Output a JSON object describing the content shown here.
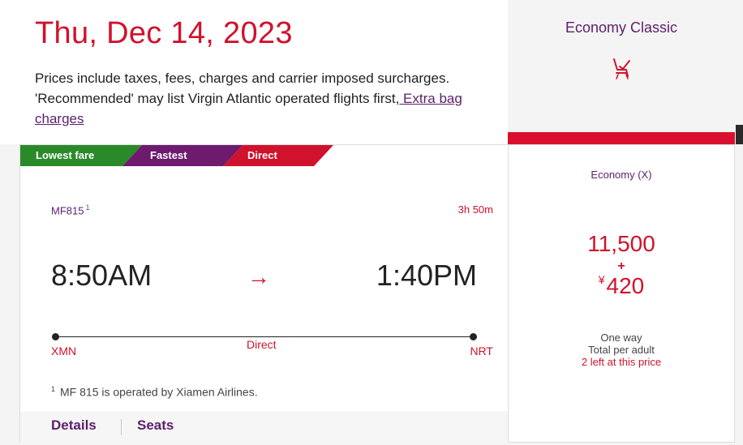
{
  "header": {
    "date": "Thu, Dec 14, 2023",
    "note_text": "Prices include taxes, fees, charges and carrier imposed surcharges. 'Recommended' may list Virgin Atlantic operated flights first,",
    "bag_link": " Extra bag charges"
  },
  "cabin": {
    "title": "Economy Classic",
    "icon": "seat-icon",
    "accent_color": "#d8102e"
  },
  "tags": {
    "lowest": "Lowest fare",
    "fastest": "Fastest",
    "direct": "Direct",
    "colors": {
      "lowest": "#2a8a2a",
      "fastest": "#6d1a6f",
      "direct": "#d0122c"
    }
  },
  "flight": {
    "number": "MF815",
    "footnote_marker": "1",
    "duration": "3h 50m",
    "departure_time": "8:50AM",
    "arrival_time": "1:40PM",
    "arrow": "→",
    "stops": "Direct",
    "origin": "XMN",
    "destination": "NRT",
    "operated_note": "MF 815 is operated by Xiamen Airlines."
  },
  "footer": {
    "details": "Details",
    "seats": "Seats"
  },
  "fare": {
    "class": "Economy (X)",
    "miles": "11,500",
    "plus": "+",
    "currency": "¥",
    "cash": "420",
    "trip_type": "One way",
    "price_basis": "Total per adult",
    "availability": "2 left at this price"
  }
}
